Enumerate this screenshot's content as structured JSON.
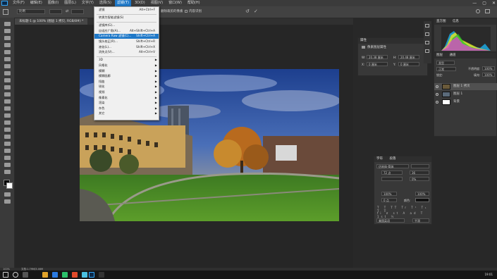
{
  "menubar": {
    "items": [
      "文件(F)",
      "编辑(E)",
      "图像(I)",
      "图层(L)",
      "文字(Y)",
      "选择(S)",
      "滤镜(T)",
      "3D(D)",
      "视图(V)",
      "窗口(W)",
      "帮助(H)"
    ],
    "active_index": 6
  },
  "window_controls": {
    "minimize": "—",
    "maximize": "▢",
    "close": "✕"
  },
  "options": {
    "preset": "比例",
    "clear_label": "清除",
    "straighten_label": "拉直",
    "delete_cropped": "删除裁剪的像素",
    "content_aware": "内容识别"
  },
  "document": {
    "tab_title": "未标题-1 @ 100% (图层 1 拷贝, RGB/8#) *"
  },
  "filter_menu": {
    "items": [
      {
        "label": "滤镜",
        "shortcut": "Alt+Ctrl+F"
      },
      {
        "label": "转换为智能滤镜(S)",
        "shortcut": ""
      },
      {
        "label": "滤镜库(G)...",
        "shortcut": ""
      },
      {
        "label": "自适应广角(A)...",
        "shortcut": "Alt+Shift+Ctrl+A"
      },
      {
        "label": "Camera Raw 滤镜(C)...",
        "shortcut": "Shift+Ctrl+A",
        "highlighted": true
      },
      {
        "label": "镜头校正(R)...",
        "shortcut": "Shift+Ctrl+R"
      },
      {
        "label": "液化(L)...",
        "shortcut": "Shift+Ctrl+X"
      },
      {
        "label": "消失点(V)...",
        "shortcut": "Alt+Ctrl+V"
      },
      {
        "label": "3D",
        "submenu": true
      },
      {
        "label": "风格化",
        "submenu": true
      },
      {
        "label": "模糊",
        "submenu": true
      },
      {
        "label": "模糊画廊",
        "submenu": true
      },
      {
        "label": "扭曲",
        "submenu": true
      },
      {
        "label": "锐化",
        "submenu": true
      },
      {
        "label": "视频",
        "submenu": true
      },
      {
        "label": "像素化",
        "submenu": true
      },
      {
        "label": "渲染",
        "submenu": true
      },
      {
        "label": "杂色",
        "submenu": true
      },
      {
        "label": "其它",
        "submenu": true
      }
    ]
  },
  "properties_panel": {
    "tab": "属性",
    "subtitle": "像素图层属性",
    "w_label": "W:",
    "w_value": "20.38 厘米",
    "h_label": "H:",
    "h_value": "20.48 厘米",
    "x_label": "X:",
    "x_value": "0 厘米",
    "y_label": "Y:",
    "y_value": "0 厘米"
  },
  "histogram_panel": {
    "tabs": [
      "直方图",
      "信息"
    ]
  },
  "layers_panel": {
    "tabs": [
      "图层",
      "通道"
    ],
    "kind": "类型",
    "blend_mode": "正常",
    "opacity_label": "不透明度:",
    "opacity": "100%",
    "lock_label": "锁定:",
    "fill_label": "填充:",
    "fill": "100%",
    "layers": [
      {
        "name": "图层 1 拷贝",
        "selected": true,
        "thumb": "#6a5a3a"
      },
      {
        "name": "图层 1",
        "selected": false,
        "thumb": "#5a6a7a"
      },
      {
        "name": "背景",
        "selected": false,
        "thumb": "#ffffff"
      }
    ]
  },
  "character_panel": {
    "tabs": [
      "字符",
      "段落"
    ],
    "font": "仿宋体-简体",
    "size": "72 点",
    "leading": "36",
    "tracking": "0%",
    "vscale": "100%",
    "hscale": "100%",
    "baseline": "0 点",
    "color_label": "颜色:",
    "language": "美国英语",
    "aa": "平滑"
  },
  "statusbar": {
    "zoom": "100%",
    "docsize": "文档:1.79M/3.46M"
  },
  "taskbar": {
    "time": "19:01"
  },
  "colors": {
    "accent": "#1e78c8",
    "menu_bg": "#f0f0f0",
    "panel": "#383838"
  }
}
